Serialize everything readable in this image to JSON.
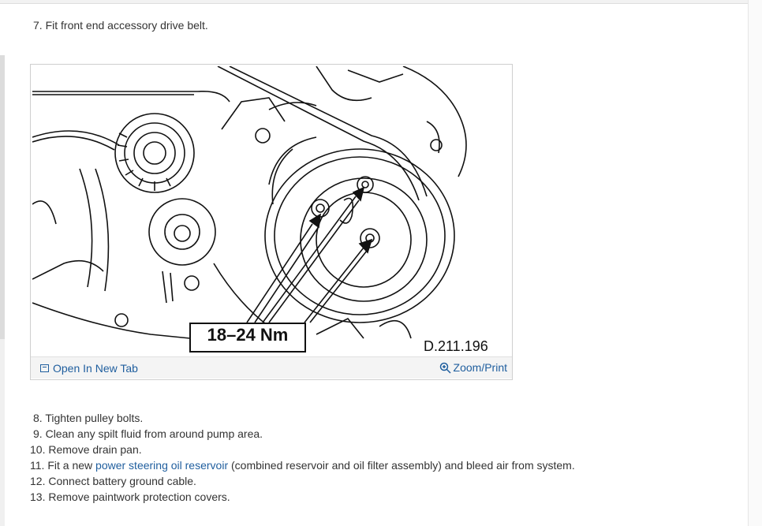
{
  "steps_before": [
    {
      "number": "7.",
      "text": "Fit front end accessory drive belt."
    }
  ],
  "figure": {
    "torque_label": "18–24 Nm",
    "figure_id": "D.211.196",
    "open_tab_label": "Open In New Tab",
    "zoom_print_label": "Zoom/Print"
  },
  "steps_after": [
    {
      "number": "8.",
      "text": "Tighten pulley bolts."
    },
    {
      "number": "9.",
      "text": "Clean any spilt fluid from around pump area."
    },
    {
      "number": "10.",
      "text": "Remove drain pan."
    },
    {
      "number": "11.",
      "pre": "Fit a new ",
      "link": "power steering oil reservoir",
      "post": " (combined reservoir and oil filter assembly) and bleed air from system."
    },
    {
      "number": "12.",
      "text": "Connect battery ground cable."
    },
    {
      "number": "13.",
      "text": "Remove paintwork protection covers."
    }
  ]
}
